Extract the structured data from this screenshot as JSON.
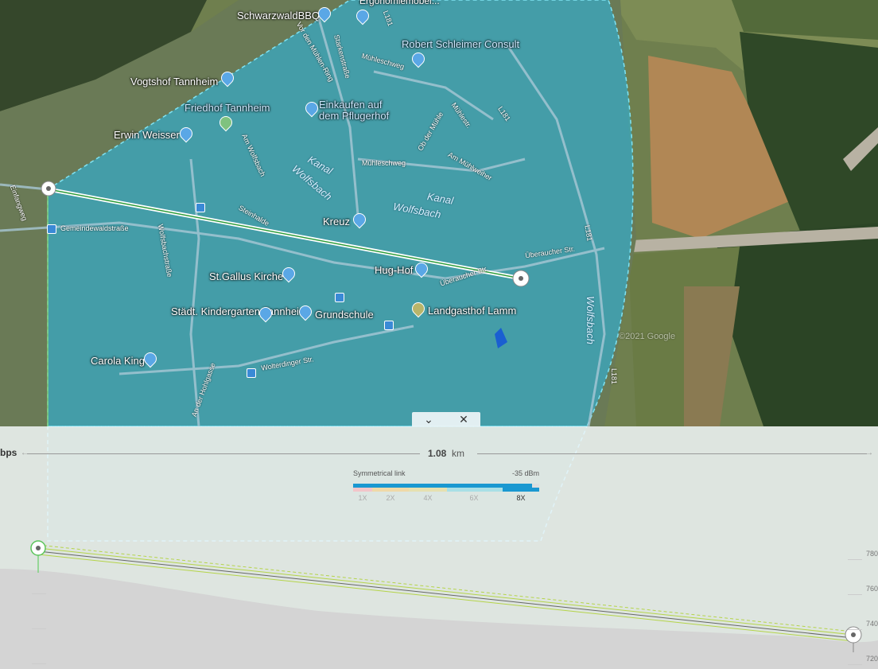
{
  "map": {
    "places": [
      {
        "name": "SchwarzwaldBBQ"
      },
      {
        "name": "Ergonomiemöbel..."
      },
      {
        "name": "Robert Schleimer Consult"
      },
      {
        "name": "Vogtshof Tannheim"
      },
      {
        "name": "Friedhof Tannheim"
      },
      {
        "name": "Einkaufen auf dem Pflugerhof"
      },
      {
        "name": "Erwin Weisser"
      },
      {
        "name": "Kreuz"
      },
      {
        "name": "Hug-Hof"
      },
      {
        "name": "St.Gallus Kirche"
      },
      {
        "name": "Städt. Kindergarten Tannheim"
      },
      {
        "name": "Grundschule"
      },
      {
        "name": "Landgasthof Lamm"
      },
      {
        "name": "Carola King"
      }
    ],
    "roads": {
      "l181_a": "L181",
      "l181_b": "L181",
      "l181_c": "L181",
      "l181_d": "L181",
      "einfangweg": "Einfangweg",
      "muehleschweg_a": "Mühleschweg",
      "muehleschweg_b": "Mühleschweg",
      "muehlestr": "Mühlestr.",
      "am_muehlweiher": "Am Mühlweiher",
      "ob_der_muehle": "Ob der Mühle",
      "starkenstrasse": "Starkenstraße",
      "vor_muehlen_ring": "Vor den Mühlen-Ring",
      "am_wolfsbach": "Am Wolfsbach",
      "gemeindewaldstrasse": "Gemeindewaldstraße",
      "steinhalde": "Steinhalde",
      "wolfsbachstrasse": "Wolfsbachstraße",
      "ueberaucher_a": "Überaucher Str.",
      "ueberaucher_b": "Überaucher Str.",
      "wolterdinger": "Wolterdinger Str.",
      "an_der_hohlgasse": "An der Hohlgasse",
      "zindelsteiner": "Zindelsteinerstr."
    },
    "water": {
      "kanal_a": "Kanal",
      "wolfsbach_a": "Wolfsbach",
      "kanal_b": "Kanal",
      "wolfsbach_b": "Wolfsbach",
      "wolfsbach_c": "Wolfsbach"
    },
    "copyright": "©2021 Google"
  },
  "panel": {
    "collapse_icon": "chevron-down",
    "close_icon": "close",
    "left_label": "bps",
    "distance_value": "1.08",
    "distance_unit": "km",
    "legend_title": "Symmetrical link",
    "legend_dbm": "-35  dBm",
    "legend_ticks": [
      "1X",
      "2X",
      "4X",
      "6X",
      "8X"
    ],
    "legend_active_index": 4,
    "elevation_labels": [
      "780",
      "760",
      "740",
      "720"
    ]
  },
  "colors": {
    "coverage": "#29b6e3",
    "link_line": "#ffffff",
    "link_green": "#5cc45c",
    "fresnel": "#b5d44a",
    "legend": [
      "#f2c5c9",
      "#efd9a8",
      "#e6e0b0",
      "#a9dfe6",
      "#5fc4dd",
      "#1a98d1"
    ]
  }
}
